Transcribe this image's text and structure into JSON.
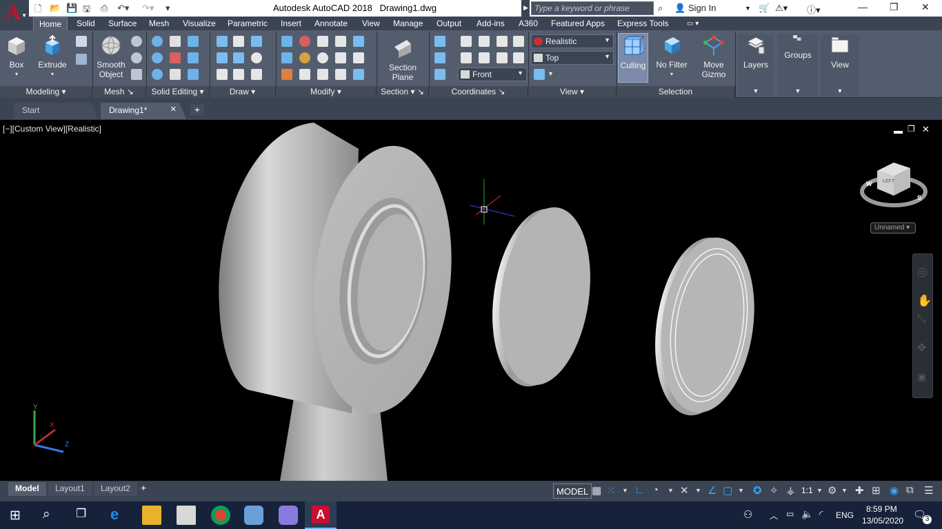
{
  "titlebar": {
    "app_name": "Autodesk AutoCAD 2018",
    "file_name": "Drawing1.dwg",
    "search_placeholder": "Type a keyword or phrase",
    "sign_in": "Sign In"
  },
  "ribbon_tabs": [
    "Home",
    "Solid",
    "Surface",
    "Mesh",
    "Visualize",
    "Parametric",
    "Insert",
    "Annotate",
    "View",
    "Manage",
    "Output",
    "Add-ins",
    "A360",
    "Featured Apps",
    "Express Tools"
  ],
  "ribbon": {
    "modeling": {
      "title": "Modeling",
      "box": "Box",
      "extrude": "Extrude"
    },
    "mesh": {
      "title": "Mesh",
      "smooth_object_1": "Smooth",
      "smooth_object_2": "Object"
    },
    "solid_editing": {
      "title": "Solid Editing"
    },
    "draw": {
      "title": "Draw"
    },
    "modify": {
      "title": "Modify"
    },
    "section": {
      "title": "Section",
      "section_plane_1": "Section",
      "section_plane_2": "Plane"
    },
    "coordinates": {
      "title": "Coordinates"
    },
    "view": {
      "title": "View",
      "visual_style": "Realistic",
      "view_top": "Top",
      "view_front": "Front"
    },
    "selection": {
      "title": "Selection",
      "culling": "Culling",
      "no_filter": "No Filter",
      "move_gizmo_1": "Move",
      "move_gizmo_2": "Gizmo"
    },
    "layers": "Layers",
    "groups": "Groups",
    "view_panel": "View"
  },
  "doc_tabs": [
    "Start",
    "Drawing1*"
  ],
  "viewport": {
    "label": "[−][Custom View][Realistic]",
    "viewcube_ucs": "Unnamed",
    "viewcube_face": "LEFT",
    "compass": {
      "w": "W",
      "s": "S"
    },
    "ucs": {
      "x": "X",
      "y": "Y",
      "z": "Z"
    }
  },
  "layout_tabs": [
    "Model",
    "Layout1",
    "Layout2"
  ],
  "status": {
    "model": "MODEL",
    "scale": "1:1"
  },
  "taskbar": {
    "language": "ENG",
    "time": "8:59 PM",
    "date": "13/05/2020",
    "notifications": "3"
  }
}
